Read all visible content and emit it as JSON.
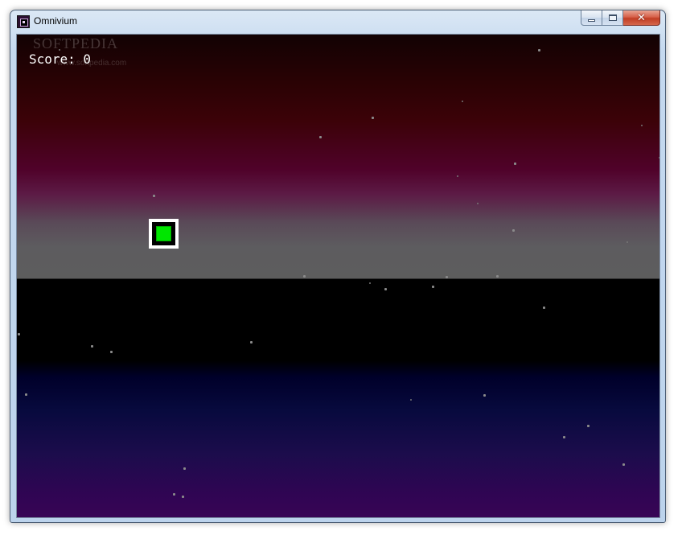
{
  "window": {
    "title": "Omnivium",
    "icons": {
      "app": "omnivium-app-icon",
      "minimize": "minimize-icon",
      "maximize": "maximize-icon",
      "close": "close-icon"
    },
    "close_glyph": "✕"
  },
  "watermark": {
    "brand": "SOFTPEDIA",
    "url": "www.softpedia.com"
  },
  "hud": {
    "score_label": "Score: 0"
  },
  "colors": {
    "player_fill": "#00e600",
    "player_frame": "#ffffff",
    "horizon_gray": "#5d5d5d",
    "floor_band": "#000000"
  }
}
